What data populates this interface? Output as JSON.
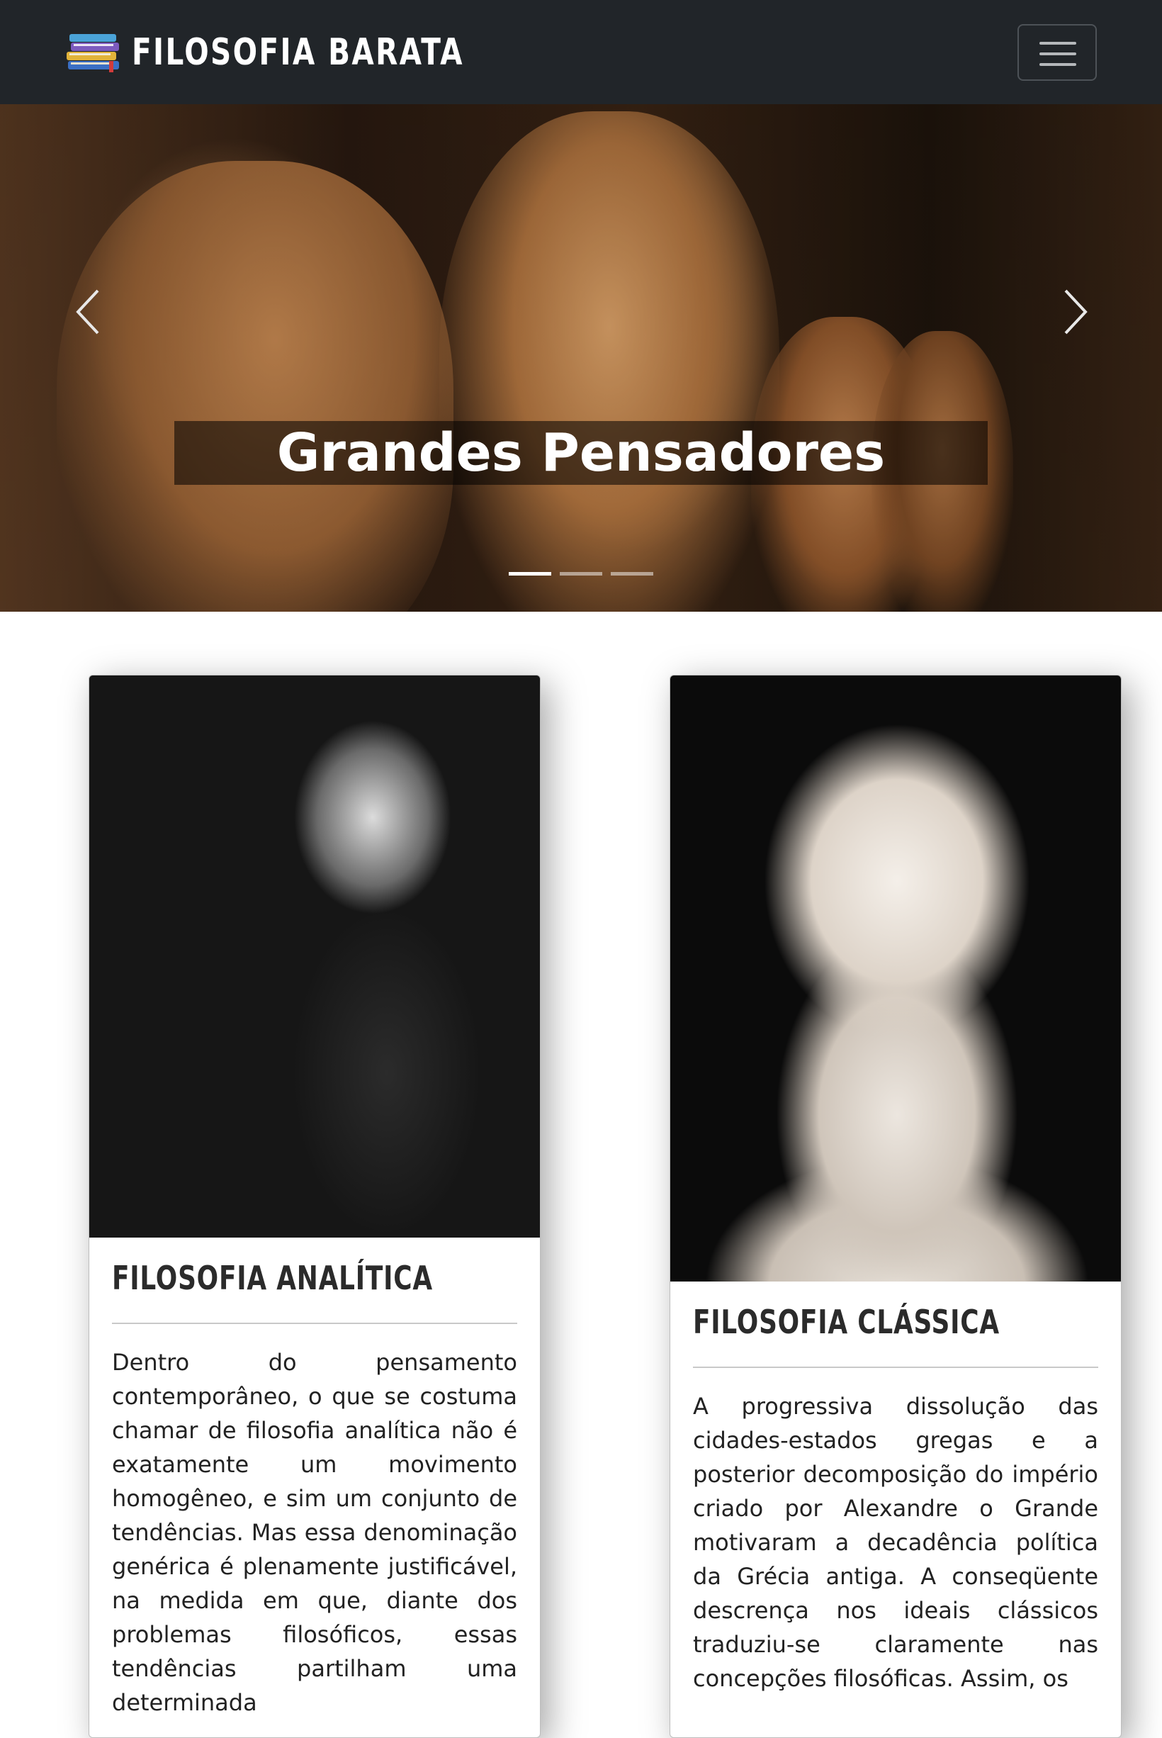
{
  "navbar": {
    "brand_title": "FILOSOFIA BARATA",
    "brand_icon": "books-icon",
    "menu_icon": "hamburger-icon"
  },
  "hero": {
    "caption": "Grandes Pensadores",
    "slides_count": 3,
    "active_slide": 1,
    "prev_icon": "chevron-left-icon",
    "next_icon": "chevron-right-icon"
  },
  "cards": [
    {
      "title": "FILOSOFIA ANALÍTICA",
      "text": "Dentro do pensamento contemporâneo, o que se costuma chamar de filosofia analítica não é exatamente um movimento homogêneo, e sim um conjunto de tendências. Mas essa denominação genérica é plenamente justificável, na medida em que, diante dos problemas filosóficos, essas tendências partilham uma determinada"
    },
    {
      "title": "FILOSOFIA CLÁSSICA",
      "text": "A progressiva dissolução das cidades-estados gregas e a posterior decomposição do império criado por Alexandre o Grande motivaram a decadência política da Grécia antiga. A conseqüente descrença nos ideais clássicos traduziu-se claramente nas concepções filosóficas. Assim, os"
    }
  ],
  "colors": {
    "navbar_bg": "#212529",
    "text": "#222222"
  }
}
